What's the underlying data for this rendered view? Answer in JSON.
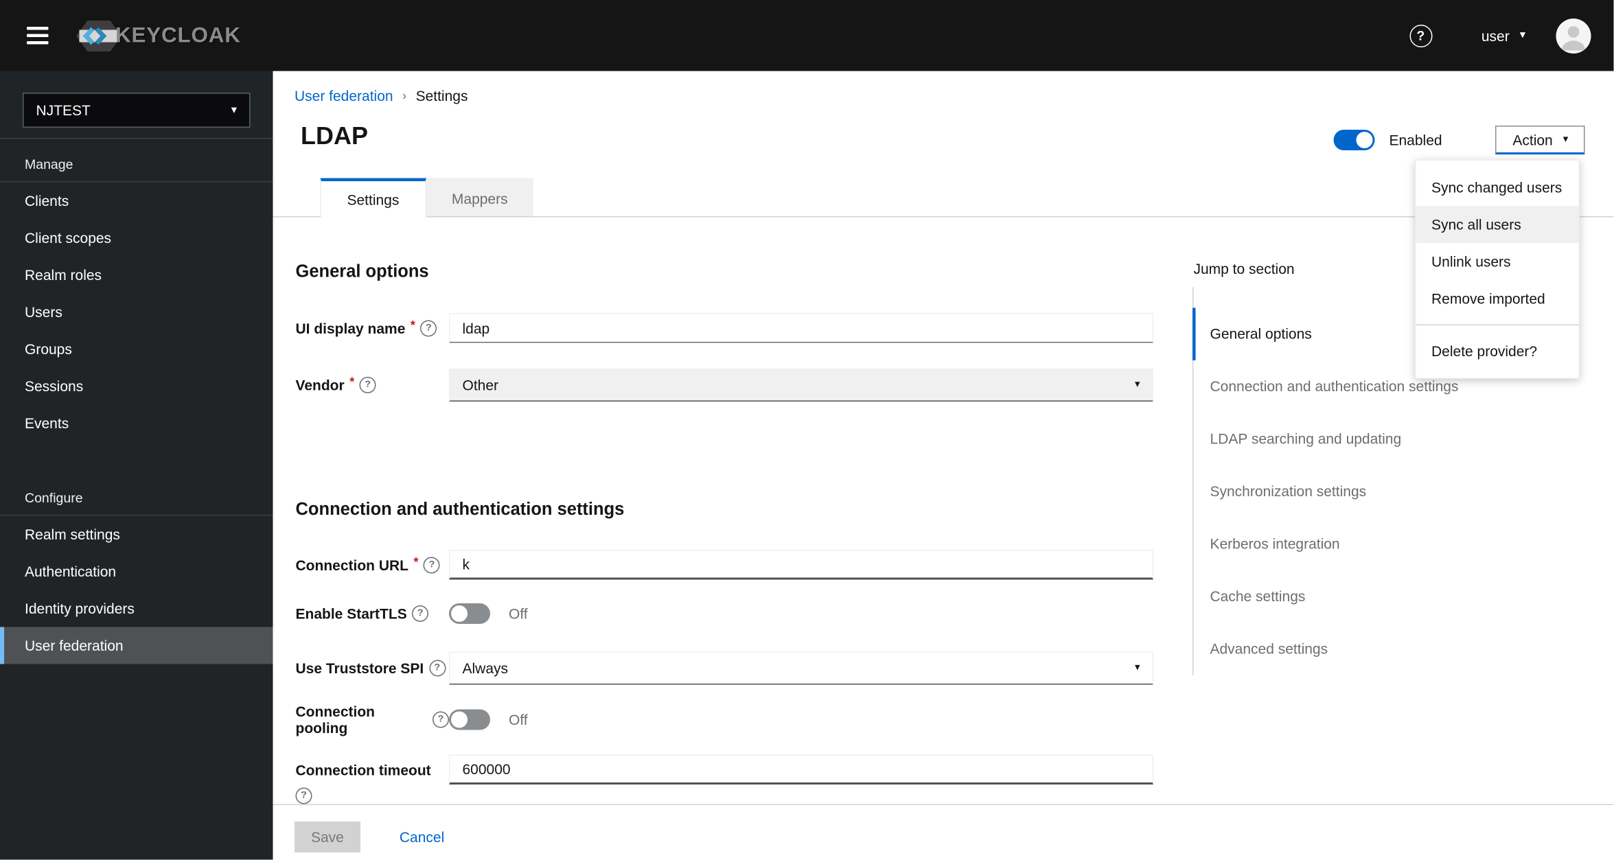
{
  "icons": {
    "help": "?",
    "caret": "▾",
    "breadcrumb_sep": "›"
  },
  "masthead": {
    "brand": "KEYCLOAK",
    "username": "user"
  },
  "sidebar": {
    "realm": "NJTEST",
    "sections": [
      {
        "label": "Manage",
        "items": [
          "Clients",
          "Client scopes",
          "Realm roles",
          "Users",
          "Groups",
          "Sessions",
          "Events"
        ]
      },
      {
        "label": "Configure",
        "items": [
          "Realm settings",
          "Authentication",
          "Identity providers",
          "User federation"
        ]
      }
    ],
    "active_item": "User federation"
  },
  "breadcrumb": {
    "link": "User federation",
    "current": "Settings"
  },
  "page": {
    "title": "LDAP",
    "enabled_label": "Enabled",
    "action_label": "Action"
  },
  "action_menu": {
    "items": [
      "Sync changed users",
      "Sync all users",
      "Unlink users",
      "Remove imported"
    ],
    "highlighted_item": "Sync all users",
    "delete_item": "Delete provider?"
  },
  "tabs": [
    {
      "label": "Settings",
      "active": true
    },
    {
      "label": "Mappers",
      "active": false
    }
  ],
  "form": {
    "required_marker": "*",
    "sections": [
      {
        "heading": "General options",
        "fields": [
          {
            "label": "UI display name",
            "type": "text",
            "value": "ldap"
          },
          {
            "label": "Vendor",
            "type": "select",
            "value": "Other"
          }
        ]
      },
      {
        "heading": "Connection and authentication settings",
        "fields": [
          {
            "label": "Connection URL",
            "type": "text",
            "value": "k"
          },
          {
            "label": "Enable StartTLS",
            "type": "switch",
            "value": "Off"
          },
          {
            "label": "Use Truststore SPI",
            "type": "select",
            "value": "Always"
          },
          {
            "label": "Connection pooling",
            "type": "switch",
            "value": "Off"
          },
          {
            "label": "Connection timeout",
            "type": "text",
            "value": "600000"
          }
        ]
      }
    ],
    "save_label": "Save",
    "cancel_label": "Cancel"
  },
  "jump_nav": {
    "heading": "Jump to section",
    "items": [
      "General options",
      "Connection and authentication settings",
      "LDAP searching and updating",
      "Synchronization settings",
      "Kerberos integration",
      "Cache settings",
      "Advanced settings"
    ],
    "active_item": "General options"
  },
  "colors": {
    "accent": "#0066cc",
    "masthead_bg": "#151515",
    "sidebar_bg": "#212427",
    "sidebar_active_bg": "#4f5255",
    "sidebar_active_border": "#73bcf7",
    "required": "#c9190b",
    "menu_highlight": "#f0f0f0",
    "disabled_button_bg": "#d2d2d2"
  }
}
